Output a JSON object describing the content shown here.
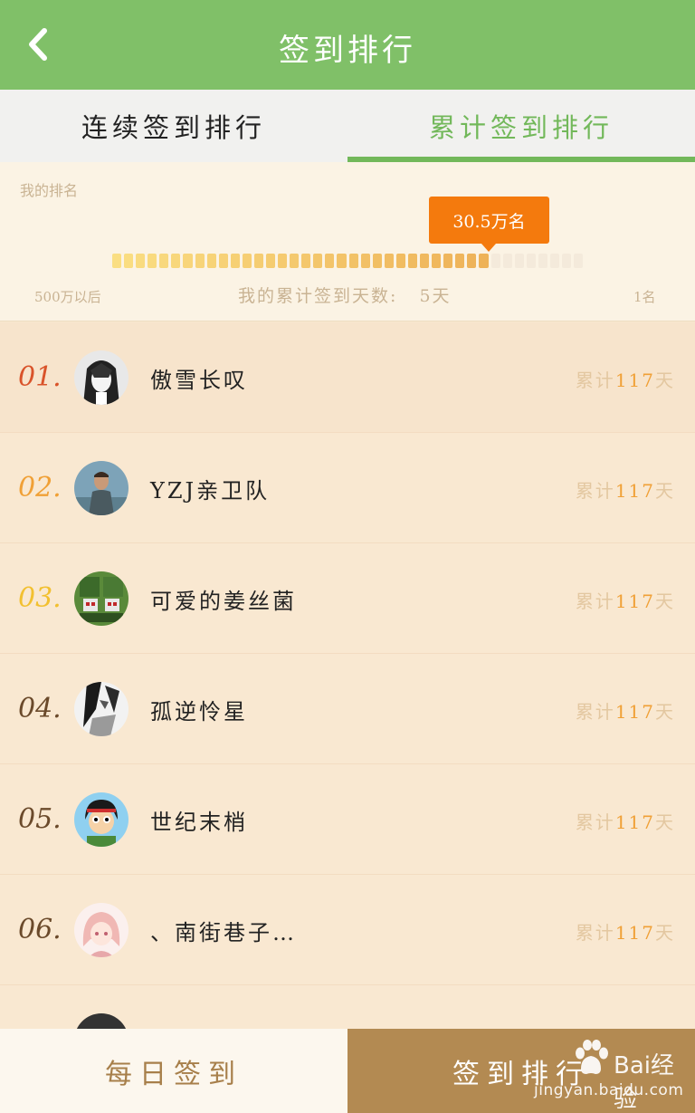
{
  "header": {
    "title": "签到排行",
    "back_icon": "chevron-left-icon"
  },
  "tabs": [
    {
      "label": "连续签到排行",
      "active": false
    },
    {
      "label": "累计签到排行",
      "active": true
    }
  ],
  "my_rank": {
    "label": "我的排名",
    "rank_bubble": "30.5万名",
    "progress_fraction": 0.8,
    "range_start": "500万以后",
    "days_label": "我的累计签到天数:",
    "days_value": "5天",
    "range_end": "1名"
  },
  "colors": {
    "header_green": "#80c068",
    "active_tab": "#72b85a",
    "bubble_orange": "#f47a0d",
    "ranking_button": "#b38a52"
  },
  "rank_list": [
    {
      "rank": "01.",
      "name": "傲雪长叹",
      "total_prefix": "累计",
      "total_num": "117",
      "total_suffix": "天",
      "rank_color": "#d9532a",
      "avatar_icon": "anime-avatar-icon"
    },
    {
      "rank": "02.",
      "name": "YZJ亲卫队",
      "total_prefix": "累计",
      "total_num": "117",
      "total_suffix": "天",
      "rank_color": "#f0a036",
      "avatar_icon": "man-avatar-icon"
    },
    {
      "rank": "03.",
      "name": "可爱的姜丝菌",
      "total_prefix": "累计",
      "total_num": "117",
      "total_suffix": "天",
      "rank_color": "#f2c030",
      "avatar_icon": "pixel-creature-avatar-icon"
    },
    {
      "rank": "04.",
      "name": "孤逆怜星",
      "total_prefix": "累计",
      "total_num": "117",
      "total_suffix": "天",
      "rank_color": "#6b4a2b",
      "avatar_icon": "sketch-avatar-icon"
    },
    {
      "rank": "05.",
      "name": "世纪末梢",
      "total_prefix": "累计",
      "total_num": "117",
      "total_suffix": "天",
      "rank_color": "#6b4a2b",
      "avatar_icon": "cartoon-boy-avatar-icon"
    },
    {
      "rank": "06.",
      "name": "、南街巷子…",
      "total_prefix": "累计",
      "total_num": "117",
      "total_suffix": "天",
      "rank_color": "#6b4a2b",
      "avatar_icon": "pink-girl-avatar-icon"
    }
  ],
  "bottom": {
    "daily_label": "每日签到",
    "ranking_label": "签到排行"
  },
  "watermark": {
    "text": "Bai经验",
    "url": "jingyan.baidu.com"
  }
}
